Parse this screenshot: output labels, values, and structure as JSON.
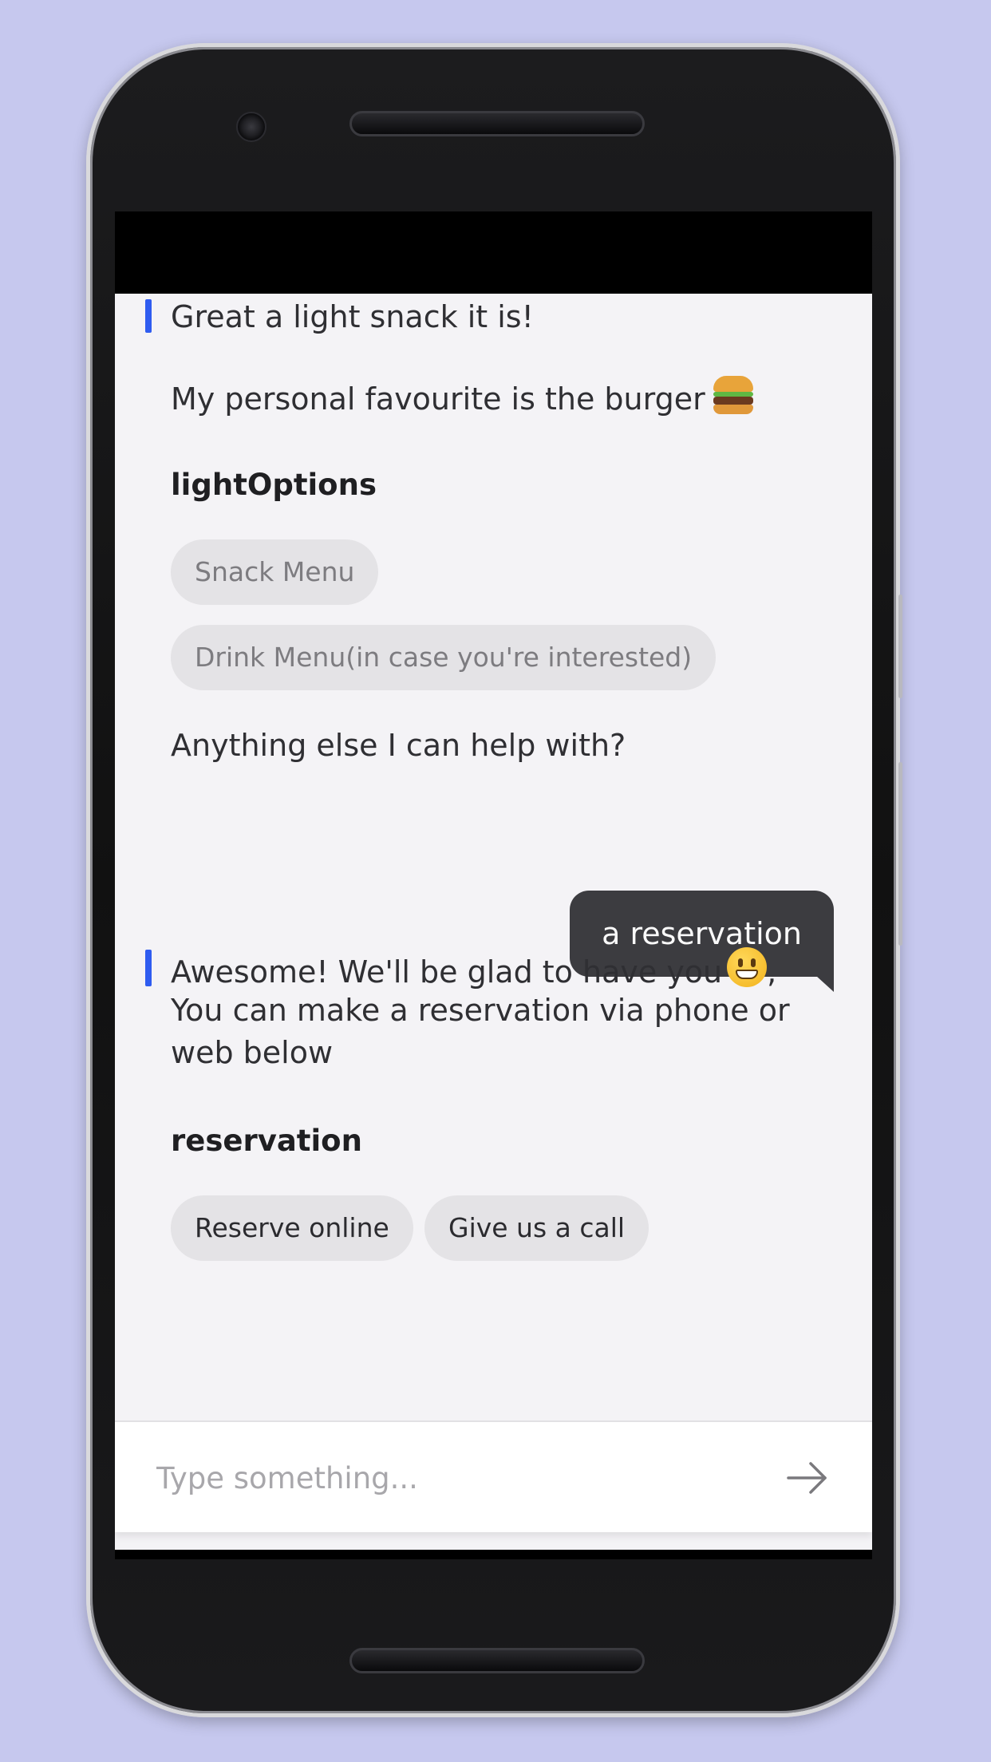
{
  "chat": {
    "msg1_line1": "Great a light snack it is!",
    "msg1_line2": "My personal favourite is the burger",
    "msg1_emoji": "hamburger-emoji",
    "light_title": "lightOptions",
    "light_options": [
      "Snack Menu",
      "Drink Menu(in case you're interested)"
    ],
    "msg1_followup": "Anything else I can help with?",
    "user_message": "a reservation",
    "msg2_line1": "Awesome! We'll be glad to have you",
    "msg2_line1_end": ",",
    "msg2_emoji": "grinning-face-emoji",
    "msg2_line2": "You can make a reservation via phone or",
    "msg2_line3": "web below",
    "reservation_title": "reservation",
    "reservation_options": [
      "Reserve online",
      "Give us a call"
    ]
  },
  "input": {
    "placeholder": "Type something...",
    "value": ""
  },
  "icons": {
    "send": "arrow-right-icon"
  },
  "colors": {
    "background": "#c6c8ee",
    "accent": "#2f5cf0",
    "user_bubble": "#3c3c40",
    "chat_bg": "#f4f3f6"
  }
}
